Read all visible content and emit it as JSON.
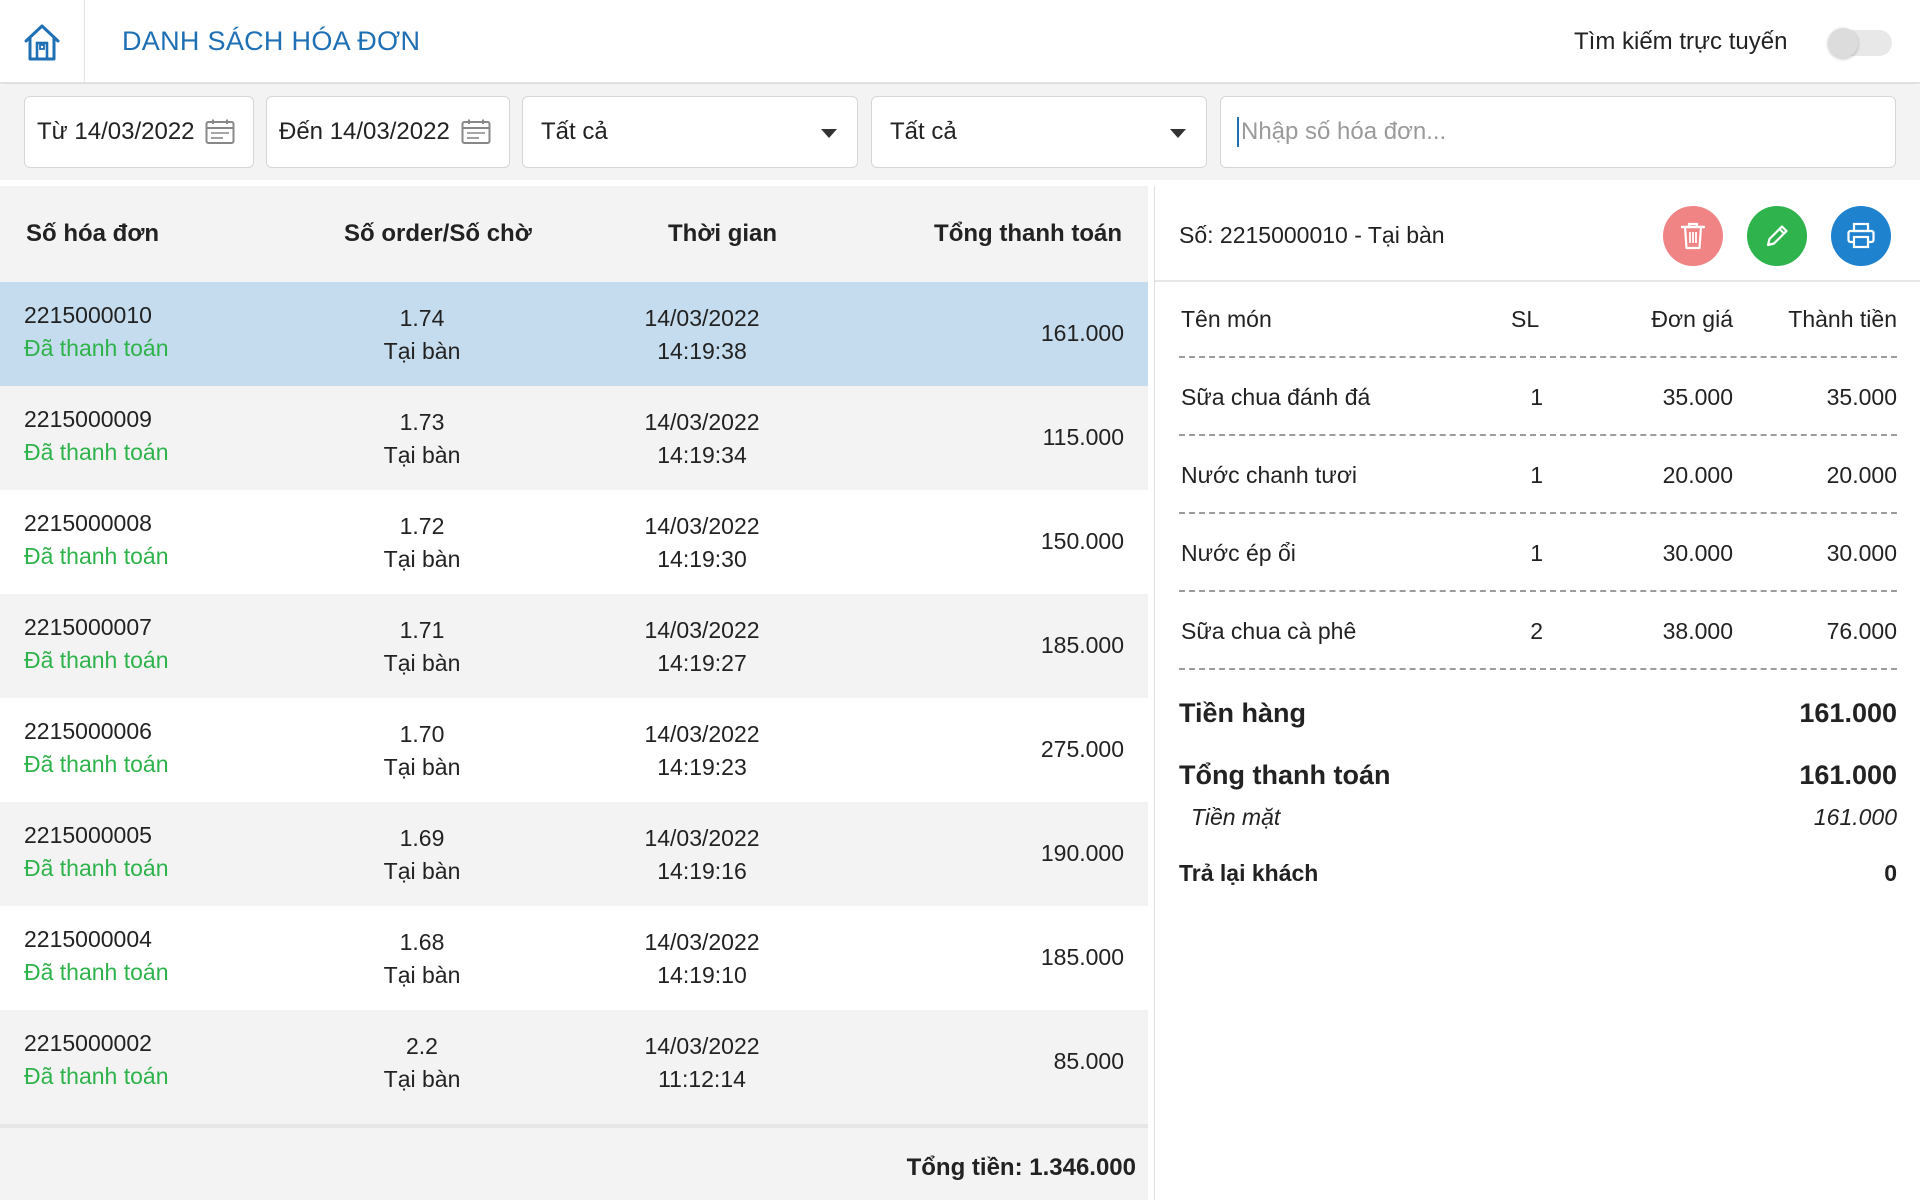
{
  "header": {
    "title": "DANH SÁCH HÓA ĐƠN",
    "online_search_label": "Tìm kiếm trực tuyến",
    "online_search_enabled": false
  },
  "filters": {
    "from_date": "Từ 14/03/2022",
    "to_date": "Đến 14/03/2022",
    "select1": "Tất cả",
    "select2": "Tất cả",
    "invoice_placeholder": "Nhập số hóa đơn..."
  },
  "table": {
    "headers": [
      "Số hóa đơn",
      "Số order/Số chờ",
      "Thời gian",
      "Tổng thanh toán"
    ],
    "rows": [
      {
        "invoice": "2215000010",
        "status": "Đã thanh toán",
        "order": "1.74",
        "type": "Tại bàn",
        "date": "14/03/2022",
        "time": "14:19:38",
        "total": "161.000"
      },
      {
        "invoice": "2215000009",
        "status": "Đã thanh toán",
        "order": "1.73",
        "type": "Tại bàn",
        "date": "14/03/2022",
        "time": "14:19:34",
        "total": "115.000"
      },
      {
        "invoice": "2215000008",
        "status": "Đã thanh toán",
        "order": "1.72",
        "type": "Tại bàn",
        "date": "14/03/2022",
        "time": "14:19:30",
        "total": "150.000"
      },
      {
        "invoice": "2215000007",
        "status": "Đã thanh toán",
        "order": "1.71",
        "type": "Tại bàn",
        "date": "14/03/2022",
        "time": "14:19:27",
        "total": "185.000"
      },
      {
        "invoice": "2215000006",
        "status": "Đã thanh toán",
        "order": "1.70",
        "type": "Tại bàn",
        "date": "14/03/2022",
        "time": "14:19:23",
        "total": "275.000"
      },
      {
        "invoice": "2215000005",
        "status": "Đã thanh toán",
        "order": "1.69",
        "type": "Tại bàn",
        "date": "14/03/2022",
        "time": "14:19:16",
        "total": "190.000"
      },
      {
        "invoice": "2215000004",
        "status": "Đã thanh toán",
        "order": "1.68",
        "type": "Tại bàn",
        "date": "14/03/2022",
        "time": "14:19:10",
        "total": "185.000"
      },
      {
        "invoice": "2215000002",
        "status": "Đã thanh toán",
        "order": "2.2",
        "type": "Tại bàn",
        "date": "14/03/2022",
        "time": "11:12:14",
        "total": "85.000"
      }
    ],
    "grand_total": "Tổng tiền: 1.346.000"
  },
  "detail": {
    "invoice_label": "Số: 2215000010 - Tại bàn",
    "columns": [
      "Tên món",
      "SL",
      "Đơn giá",
      "Thành tiền"
    ],
    "items": [
      {
        "name": "Sữa chua đánh đá",
        "qty": "1",
        "price": "35.000",
        "amount": "35.000"
      },
      {
        "name": "Nước chanh tươi",
        "qty": "1",
        "price": "20.000",
        "amount": "20.000"
      },
      {
        "name": "Nước ép ổi",
        "qty": "1",
        "price": "30.000",
        "amount": "30.000"
      },
      {
        "name": "Sữa chua cà phê",
        "qty": "2",
        "price": "38.000",
        "amount": "76.000"
      }
    ],
    "subtotal_label": "Tiền hàng",
    "subtotal": "161.000",
    "total_label": "Tổng thanh toán",
    "total": "161.000",
    "cash_label": "Tiền mặt",
    "cash": "161.000",
    "change_label": "Trả lại khách",
    "change": "0"
  },
  "colors": {
    "brand": "#1f6fb5",
    "paid": "#2eb34a",
    "selected_row": "#c4dced",
    "delete": "#f08383",
    "edit": "#2fb34d",
    "print": "#1f82cf"
  },
  "icons": [
    "home-icon",
    "calendar-icon",
    "dropdown-arrow-icon",
    "trash-icon",
    "pencil-icon",
    "printer-icon"
  ]
}
